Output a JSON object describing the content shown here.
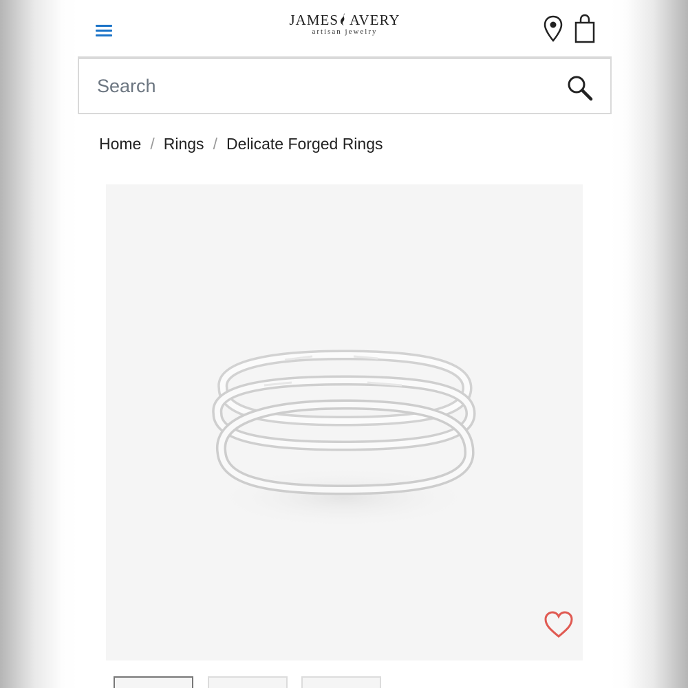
{
  "header": {
    "logo_main_left": "JAMES",
    "logo_main_right": "AVERY",
    "logo_sub": "artisan jewelry",
    "menu_icon": "hamburger-menu-icon",
    "location_icon": "map-pin-icon",
    "bag_icon": "shopping-bag-icon",
    "accent_color": "#1a73c8"
  },
  "search": {
    "placeholder": "Search",
    "value": "",
    "icon": "search-icon"
  },
  "breadcrumb": {
    "items": [
      "Home",
      "Rings",
      "Delicate Forged Rings"
    ],
    "separator": "/"
  },
  "product": {
    "image": "three stacked hammered silver rings",
    "favorite_icon": "heart-outline-icon",
    "favorite_color": "#e05a52",
    "thumbnails_visible": 3,
    "active_thumbnail": 1
  }
}
